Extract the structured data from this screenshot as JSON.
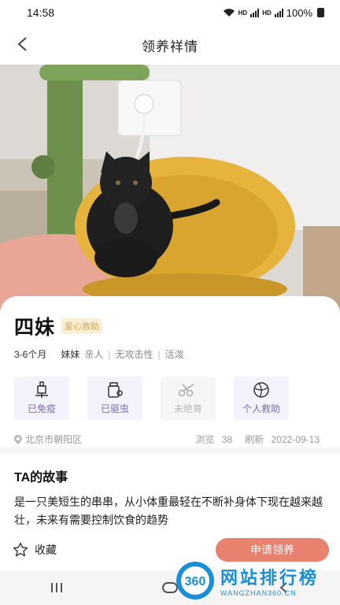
{
  "status_bar": {
    "time": "14:58",
    "net1": "HD",
    "net2": "HD",
    "battery": "100%"
  },
  "header": {
    "title": "领养祥情"
  },
  "pet": {
    "name": "四妹",
    "tag": "爱心救助",
    "age": "3-6个月",
    "gender": "妹妹",
    "traits": [
      "亲人",
      "无攻击性",
      "活泼"
    ]
  },
  "badges": [
    {
      "label": "已免疫",
      "icon": "vaccine-icon",
      "active": true
    },
    {
      "label": "已驱虫",
      "icon": "deworm-icon",
      "active": true
    },
    {
      "label": "未绝育",
      "icon": "scissors-icon",
      "active": false
    },
    {
      "label": "个人救助",
      "icon": "ball-icon",
      "active": true
    }
  ],
  "meta": {
    "location": "北京市朝阳区",
    "views_label": "浏览",
    "views": "38",
    "refresh_label": "刷新",
    "refresh_date": "2022-09-13"
  },
  "story": {
    "title": "TA的故事",
    "text": "是一只美短生的串串，从小体重最轻在不断补身体下现在越来越壮，未来有需要控制饮食的趋势"
  },
  "actions": {
    "favorite_label": "收藏",
    "apply_label": "申请领养"
  },
  "watermark": {
    "number": "360",
    "main": "网站排行榜",
    "sub": "WANGZHAN360.CN"
  },
  "colors": {
    "accent": "#e8816e",
    "badge_text": "#7b6ab5",
    "tag_bg": "#fbf0d6",
    "tag_text": "#d8a94a"
  }
}
